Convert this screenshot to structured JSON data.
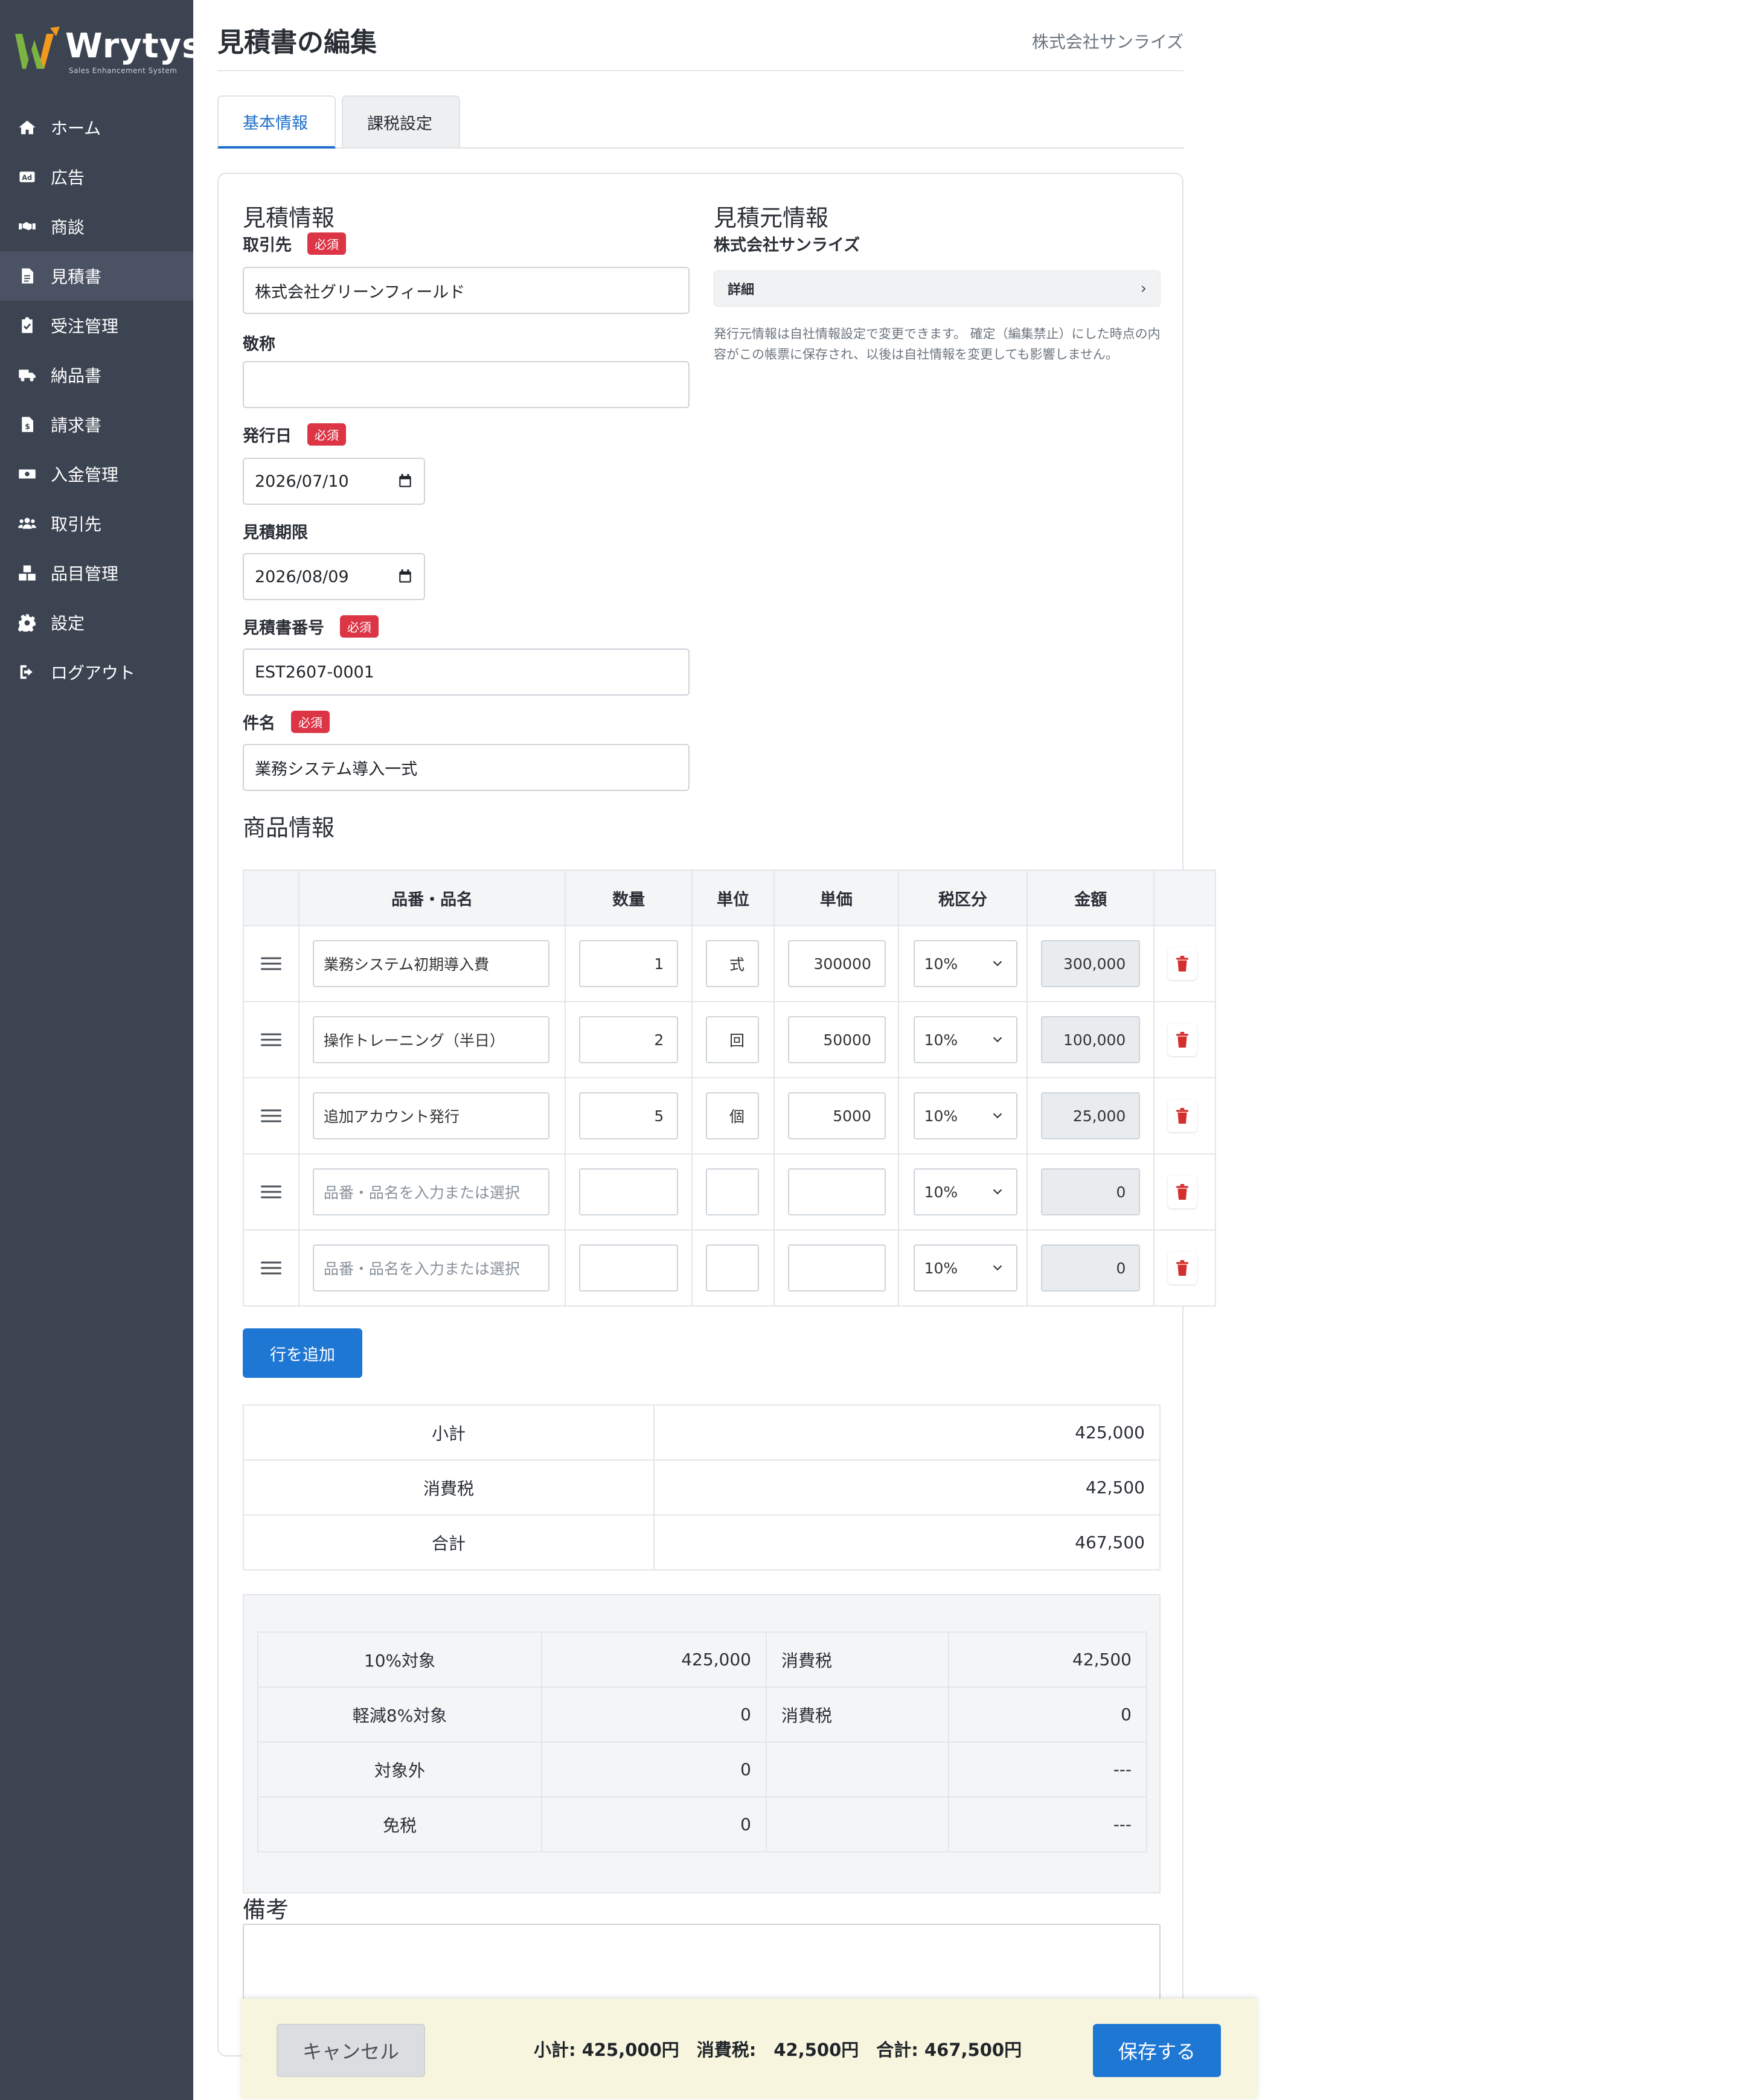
{
  "app": {
    "brand": "Wrytys",
    "brand_tagline": "Sales Enhancement System",
    "accent": "#1f77d4",
    "sidebar_bg": "#3c4452",
    "danger": "#dc3545"
  },
  "sidebar": {
    "items": [
      {
        "label": "ホーム",
        "icon": "home-icon"
      },
      {
        "label": "広告",
        "icon": "ad-icon"
      },
      {
        "label": "商談",
        "icon": "handshake-icon"
      },
      {
        "label": "見積書",
        "icon": "document-icon",
        "active": true
      },
      {
        "label": "受注管理",
        "icon": "clipboard-check-icon"
      },
      {
        "label": "納品書",
        "icon": "truck-icon"
      },
      {
        "label": "請求書",
        "icon": "invoice-icon"
      },
      {
        "label": "入金管理",
        "icon": "money-icon"
      },
      {
        "label": "取引先",
        "icon": "users-icon"
      },
      {
        "label": "品目管理",
        "icon": "boxes-icon"
      },
      {
        "label": "設定",
        "icon": "gear-icon"
      },
      {
        "label": "ログアウト",
        "icon": "logout-icon"
      }
    ]
  },
  "header": {
    "title": "見積書の編集",
    "company": "株式会社サンライズ"
  },
  "tabs": [
    {
      "label": "基本情報",
      "active": true
    },
    {
      "label": "課税設定",
      "active": false
    }
  ],
  "estimate": {
    "section_title": "見積情報",
    "required_badge": "必須",
    "client_label": "取引先",
    "client_value": "株式会社グリーンフィールド",
    "honorific_label": "敬称",
    "honorific_value": "",
    "issue_date_label": "発行日",
    "issue_date_value": "2026/07/10",
    "expiry_label": "見積期限",
    "expiry_value": "2026/08/09",
    "number_label": "見積書番号",
    "number_value": "EST2607-0001",
    "subject_label": "件名",
    "subject_value": "業務システム導入一式"
  },
  "issuer": {
    "section_title": "見積元情報",
    "company_name": "株式会社サンライズ",
    "detail_label": "詳細",
    "note": "発行元情報は自社情報設定で変更できます。 確定（編集禁止）にした時点の内容がこの帳票に保存され、以後は自社情報を変更しても影響しません。"
  },
  "products": {
    "section_title": "商品情報",
    "columns": [
      "品番・品名",
      "数量",
      "単位",
      "単価",
      "税区分",
      "金額"
    ],
    "placeholder": "品番・品名を入力または選択",
    "rows": [
      {
        "name": "業務システム初期導入費",
        "qty": "1",
        "unit": "式",
        "price": "300000",
        "tax": "10%",
        "amount": "300,000"
      },
      {
        "name": "操作トレーニング（半日）",
        "qty": "2",
        "unit": "回",
        "price": "50000",
        "tax": "10%",
        "amount": "100,000"
      },
      {
        "name": "追加アカウント発行",
        "qty": "5",
        "unit": "個",
        "price": "5000",
        "tax": "10%",
        "amount": "25,000"
      },
      {
        "name": "",
        "qty": "",
        "unit": "",
        "price": "",
        "tax": "10%",
        "amount": "0"
      },
      {
        "name": "",
        "qty": "",
        "unit": "",
        "price": "",
        "tax": "10%",
        "amount": "0"
      }
    ],
    "add_row_label": "行を追加"
  },
  "summary": [
    {
      "label": "小計",
      "value": "425,000"
    },
    {
      "label": "消費税",
      "value": "42,500"
    },
    {
      "label": "合計",
      "value": "467,500"
    }
  ],
  "tax_breakdown": [
    {
      "label": "10%対象",
      "base": "425,000",
      "tax_label": "消費税",
      "tax": "42,500"
    },
    {
      "label": "軽減8%対象",
      "base": "0",
      "tax_label": "消費税",
      "tax": "0"
    },
    {
      "label": "対象外",
      "base": "0",
      "tax_label": "",
      "tax": "---"
    },
    {
      "label": "免税",
      "base": "0",
      "tax_label": "",
      "tax": "---"
    }
  ],
  "remarks": {
    "label": "備考",
    "value": ""
  },
  "footer": {
    "cancel_label": "キャンセル",
    "totals_text": "小計: 425,000円　消費税:　42,500円　合計: 467,500円",
    "save_label": "保存する"
  }
}
